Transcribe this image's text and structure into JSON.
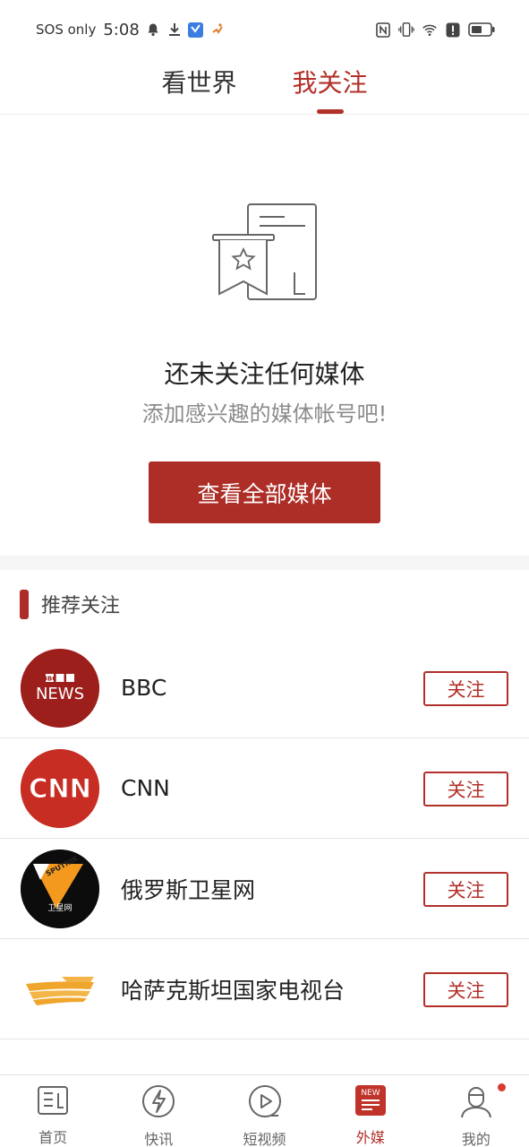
{
  "status_bar": {
    "carrier": "SOS only",
    "time": "5:08",
    "left_icons": [
      "bell-icon",
      "download-icon",
      "app-badge-icon",
      "runner-icon"
    ],
    "right_icons": [
      "nfc-icon",
      "vibrate-icon",
      "wifi-icon",
      "alert-icon",
      "battery-icon"
    ]
  },
  "top_tabs": [
    {
      "label": "看世界",
      "active": false
    },
    {
      "label": "我关注",
      "active": true
    }
  ],
  "empty_state": {
    "title": "还未关注任何媒体",
    "subtitle": "添加感兴趣的媒体帐号吧!",
    "button_label": "查看全部媒体"
  },
  "recommended": {
    "title": "推荐关注",
    "follow_label": "关注",
    "items": [
      {
        "name": "BBC",
        "logo_lines": [
          "BBC",
          "NEWS"
        ]
      },
      {
        "name": "CNN",
        "logo_lines": [
          "CNN"
        ]
      },
      {
        "name": "俄罗斯卫星网",
        "logo_lines": [
          "SPUTNIK",
          "卫星网"
        ]
      },
      {
        "name": "哈萨克斯坦国家电视台",
        "logo_lines": []
      }
    ]
  },
  "bottom_nav": [
    {
      "label": "首页",
      "icon": "news-icon",
      "active": false
    },
    {
      "label": "快讯",
      "icon": "flash-icon",
      "active": false
    },
    {
      "label": "短视频",
      "icon": "play-icon",
      "active": false
    },
    {
      "label": "外媒",
      "icon": "new-badge-icon",
      "badge_text": "NEW",
      "active": true
    },
    {
      "label": "我的",
      "icon": "profile-icon",
      "active": false,
      "has_dot": true
    }
  ],
  "colors": {
    "brand_red": "#ad2d27",
    "text_dark": "#222222",
    "text_muted": "#8c8c8c"
  }
}
